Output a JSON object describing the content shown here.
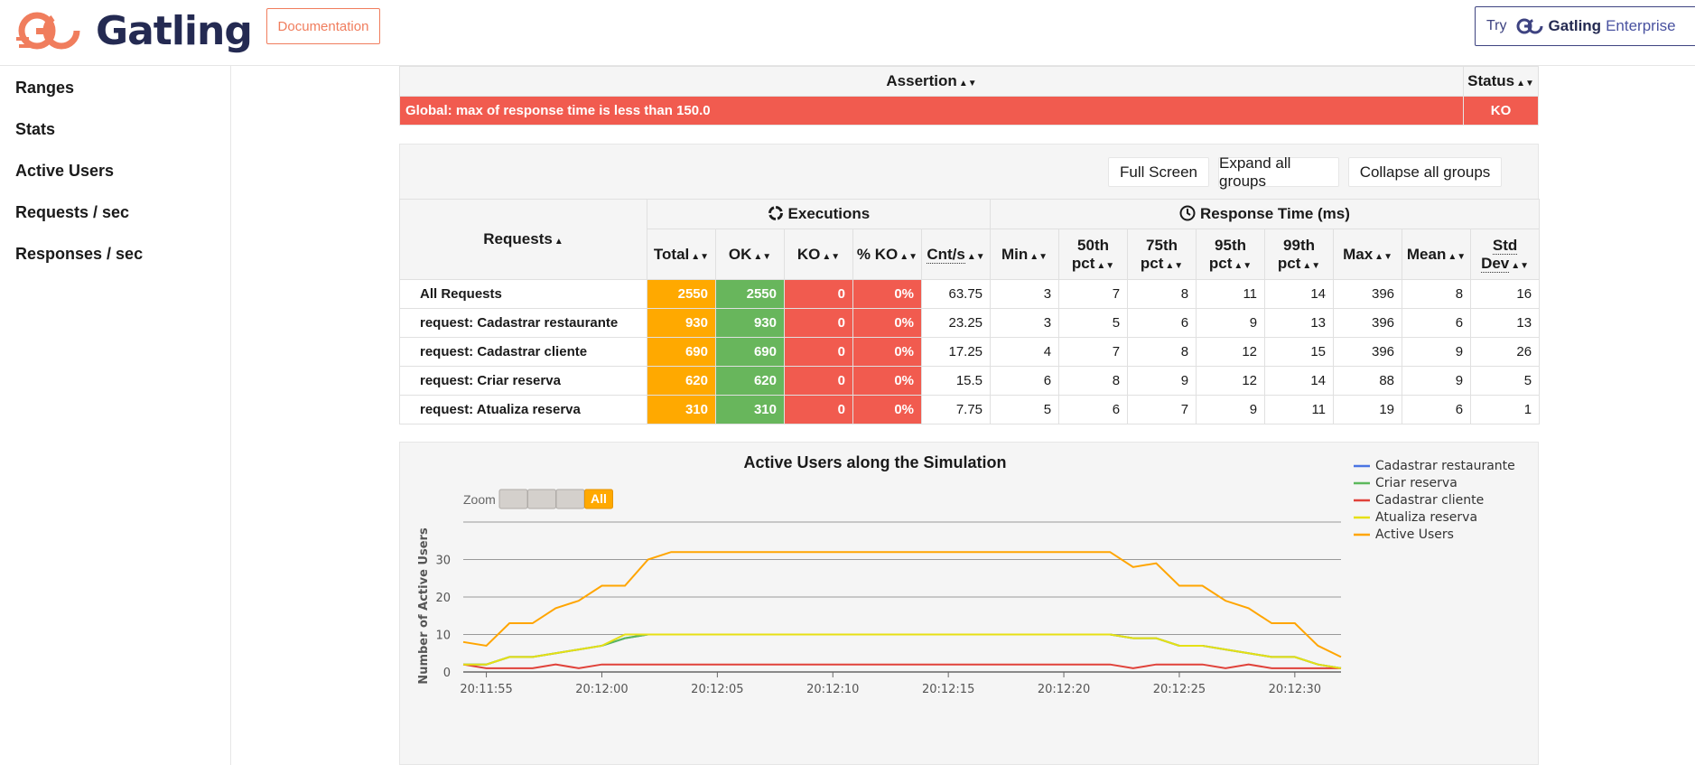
{
  "header": {
    "logo_text": "Gatling",
    "documentation_label": "Documentation",
    "try_label": "Try",
    "brand_label": "Gatling",
    "enterprise_label": "Enterprise"
  },
  "sidebar": {
    "items": [
      {
        "label": "Ranges"
      },
      {
        "label": "Stats"
      },
      {
        "label": "Active Users"
      },
      {
        "label": "Requests / sec"
      },
      {
        "label": "Responses / sec"
      }
    ]
  },
  "assertions": {
    "header_assertion": "Assertion",
    "header_status": "Status",
    "rows": [
      {
        "assertion": "Global: max of response time is less than 150.0",
        "status": "KO"
      }
    ]
  },
  "stats": {
    "buttons": {
      "full_screen": "Full Screen",
      "expand": "Expand all groups",
      "collapse": "Collapse all groups"
    },
    "group_executions": "Executions",
    "group_response_time": "Response Time (ms)",
    "requests_header": "Requests",
    "columns": {
      "total": "Total",
      "ok": "OK",
      "ko": "KO",
      "pct_ko": "% KO",
      "cnt_s": "Cnt/s",
      "min": "Min",
      "p50_a": "50th",
      "p50_b": "pct",
      "p75_a": "75th",
      "p75_b": "pct",
      "p95_a": "95th",
      "p95_b": "pct",
      "p99_a": "99th",
      "p99_b": "pct",
      "max": "Max",
      "mean": "Mean",
      "std_a": "Std",
      "std_b": "Dev"
    },
    "rows": [
      {
        "name": "All Requests",
        "total": "2550",
        "ok": "2550",
        "ko": "0",
        "pct_ko": "0%",
        "cnt_s": "63.75",
        "min": "3",
        "p50": "7",
        "p75": "8",
        "p95": "11",
        "p99": "14",
        "max": "396",
        "mean": "8",
        "std": "16"
      },
      {
        "name": "request: Cadastrar restaurante",
        "total": "930",
        "ok": "930",
        "ko": "0",
        "pct_ko": "0%",
        "cnt_s": "23.25",
        "min": "3",
        "p50": "5",
        "p75": "6",
        "p95": "9",
        "p99": "13",
        "max": "396",
        "mean": "6",
        "std": "13"
      },
      {
        "name": "request: Cadastrar cliente",
        "total": "690",
        "ok": "690",
        "ko": "0",
        "pct_ko": "0%",
        "cnt_s": "17.25",
        "min": "4",
        "p50": "7",
        "p75": "8",
        "p95": "12",
        "p99": "15",
        "max": "396",
        "mean": "9",
        "std": "26"
      },
      {
        "name": "request: Criar reserva",
        "total": "620",
        "ok": "620",
        "ko": "0",
        "pct_ko": "0%",
        "cnt_s": "15.5",
        "min": "6",
        "p50": "8",
        "p75": "9",
        "p95": "12",
        "p99": "14",
        "max": "88",
        "mean": "9",
        "std": "5"
      },
      {
        "name": "request: Atualiza reserva",
        "total": "310",
        "ok": "310",
        "ko": "0",
        "pct_ko": "0%",
        "cnt_s": "7.75",
        "min": "5",
        "p50": "6",
        "p75": "7",
        "p95": "9",
        "p99": "11",
        "max": "19",
        "mean": "6",
        "std": "1"
      }
    ]
  },
  "colors": {
    "brand_orange": "#f07d5d",
    "brand_navy": "#242a52",
    "total_cell": "#ffa900",
    "ok_cell": "#68b65c",
    "ko_cell": "#f15b4f"
  },
  "chart_zoom": {
    "label": "Zoom",
    "options": [
      "",
      "",
      "",
      "All"
    ],
    "selected": "All"
  },
  "chart_data": {
    "type": "line",
    "title": "Active Users along the Simulation",
    "ylabel": "Number of Active Users",
    "xlabel": "",
    "ylim": [
      0,
      40
    ],
    "yticks": [
      0,
      10,
      20,
      30
    ],
    "xticks": [
      "20:11:55",
      "20:12:00",
      "20:12:05",
      "20:12:10",
      "20:12:15",
      "20:12:20",
      "20:12:25",
      "20:12:30"
    ],
    "x": [
      "20:11:54",
      "20:11:55",
      "20:11:56",
      "20:11:57",
      "20:11:58",
      "20:11:59",
      "20:12:00",
      "20:12:01",
      "20:12:02",
      "20:12:03",
      "20:12:04",
      "20:12:05",
      "20:12:06",
      "20:12:07",
      "20:12:08",
      "20:12:09",
      "20:12:10",
      "20:12:11",
      "20:12:12",
      "20:12:13",
      "20:12:14",
      "20:12:15",
      "20:12:16",
      "20:12:17",
      "20:12:18",
      "20:12:19",
      "20:12:20",
      "20:12:21",
      "20:12:22",
      "20:12:23",
      "20:12:24",
      "20:12:25",
      "20:12:26",
      "20:12:27",
      "20:12:28",
      "20:12:29",
      "20:12:30",
      "20:12:31",
      "20:12:32"
    ],
    "legend_position": "top-right",
    "series": [
      {
        "name": "Cadastrar restaurante",
        "color": "#4a74e3",
        "values": [
          2,
          2,
          4,
          4,
          5,
          6,
          7,
          9,
          10,
          10,
          10,
          10,
          10,
          10,
          10,
          10,
          10,
          10,
          10,
          10,
          10,
          10,
          10,
          10,
          10,
          10,
          10,
          10,
          10,
          9,
          9,
          7,
          7,
          6,
          5,
          4,
          4,
          2,
          1
        ]
      },
      {
        "name": "Criar reserva",
        "color": "#5cb85c",
        "values": [
          2,
          2,
          4,
          4,
          5,
          6,
          7,
          9,
          10,
          10,
          10,
          10,
          10,
          10,
          10,
          10,
          10,
          10,
          10,
          10,
          10,
          10,
          10,
          10,
          10,
          10,
          10,
          10,
          10,
          9,
          9,
          7,
          7,
          6,
          5,
          4,
          4,
          2,
          1
        ]
      },
      {
        "name": "Cadastrar cliente",
        "color": "#e0423a",
        "values": [
          2,
          1,
          1,
          1,
          2,
          1,
          2,
          2,
          2,
          2,
          2,
          2,
          2,
          2,
          2,
          2,
          2,
          2,
          2,
          2,
          2,
          2,
          2,
          2,
          2,
          2,
          2,
          2,
          2,
          1,
          2,
          2,
          2,
          1,
          2,
          1,
          1,
          1,
          1
        ]
      },
      {
        "name": "Atualiza reserva",
        "color": "#e6e014",
        "values": [
          2,
          2,
          4,
          4,
          5,
          6,
          7,
          10,
          10,
          10,
          10,
          10,
          10,
          10,
          10,
          10,
          10,
          10,
          10,
          10,
          10,
          10,
          10,
          10,
          10,
          10,
          10,
          10,
          10,
          9,
          9,
          7,
          7,
          6,
          5,
          4,
          4,
          2,
          1
        ]
      },
      {
        "name": "Active Users",
        "color": "#ffa500",
        "values": [
          8,
          7,
          13,
          13,
          17,
          19,
          23,
          23,
          30,
          32,
          32,
          32,
          32,
          32,
          32,
          32,
          32,
          32,
          32,
          32,
          32,
          32,
          32,
          32,
          32,
          32,
          32,
          32,
          32,
          28,
          29,
          23,
          23,
          19,
          17,
          13,
          13,
          7,
          4
        ]
      }
    ]
  }
}
